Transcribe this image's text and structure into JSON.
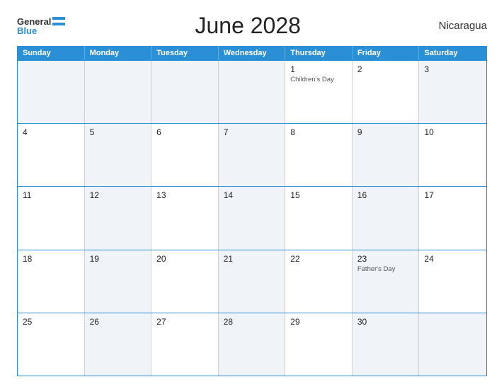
{
  "header": {
    "logo_general": "General",
    "logo_blue": "Blue",
    "title": "June 2028",
    "country": "Nicaragua"
  },
  "calendar": {
    "weekdays": [
      "Sunday",
      "Monday",
      "Tuesday",
      "Wednesday",
      "Thursday",
      "Friday",
      "Saturday"
    ],
    "weeks": [
      [
        {
          "day": "",
          "holiday": "",
          "shaded": true
        },
        {
          "day": "",
          "holiday": "",
          "shaded": true
        },
        {
          "day": "",
          "holiday": "",
          "shaded": true
        },
        {
          "day": "",
          "holiday": "",
          "shaded": true
        },
        {
          "day": "1",
          "holiday": "Children's Day",
          "shaded": false
        },
        {
          "day": "2",
          "holiday": "",
          "shaded": false
        },
        {
          "day": "3",
          "holiday": "",
          "shaded": true
        }
      ],
      [
        {
          "day": "4",
          "holiday": "",
          "shaded": false
        },
        {
          "day": "5",
          "holiday": "",
          "shaded": true
        },
        {
          "day": "6",
          "holiday": "",
          "shaded": false
        },
        {
          "day": "7",
          "holiday": "",
          "shaded": true
        },
        {
          "day": "8",
          "holiday": "",
          "shaded": false
        },
        {
          "day": "9",
          "holiday": "",
          "shaded": true
        },
        {
          "day": "10",
          "holiday": "",
          "shaded": false
        }
      ],
      [
        {
          "day": "11",
          "holiday": "",
          "shaded": false
        },
        {
          "day": "12",
          "holiday": "",
          "shaded": true
        },
        {
          "day": "13",
          "holiday": "",
          "shaded": false
        },
        {
          "day": "14",
          "holiday": "",
          "shaded": true
        },
        {
          "day": "15",
          "holiday": "",
          "shaded": false
        },
        {
          "day": "16",
          "holiday": "",
          "shaded": true
        },
        {
          "day": "17",
          "holiday": "",
          "shaded": false
        }
      ],
      [
        {
          "day": "18",
          "holiday": "",
          "shaded": false
        },
        {
          "day": "19",
          "holiday": "",
          "shaded": true
        },
        {
          "day": "20",
          "holiday": "",
          "shaded": false
        },
        {
          "day": "21",
          "holiday": "",
          "shaded": true
        },
        {
          "day": "22",
          "holiday": "",
          "shaded": false
        },
        {
          "day": "23",
          "holiday": "Father's Day",
          "shaded": true
        },
        {
          "day": "24",
          "holiday": "",
          "shaded": false
        }
      ],
      [
        {
          "day": "25",
          "holiday": "",
          "shaded": false
        },
        {
          "day": "26",
          "holiday": "",
          "shaded": true
        },
        {
          "day": "27",
          "holiday": "",
          "shaded": false
        },
        {
          "day": "28",
          "holiday": "",
          "shaded": true
        },
        {
          "day": "29",
          "holiday": "",
          "shaded": false
        },
        {
          "day": "30",
          "holiday": "",
          "shaded": true
        },
        {
          "day": "",
          "holiday": "",
          "shaded": false
        }
      ]
    ]
  }
}
